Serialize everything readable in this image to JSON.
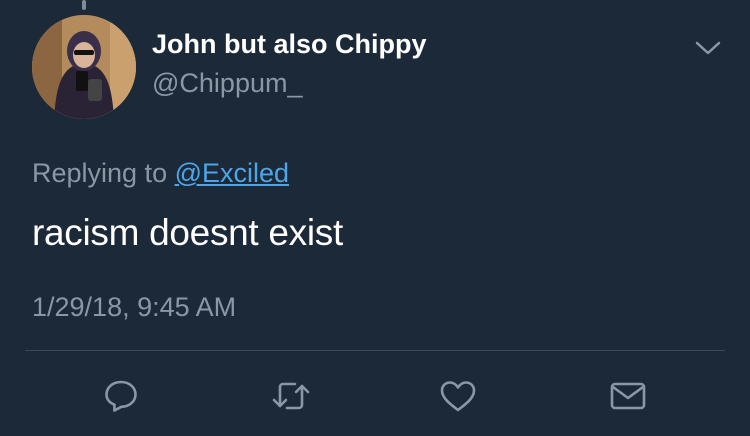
{
  "tweet": {
    "display_name": "John but also Chippy",
    "handle": "@Chippum_",
    "replying_prefix": "Replying to ",
    "replying_to": "@Exciled",
    "text": "racism doesnt exist",
    "timestamp": "1/29/18, 9:45 AM"
  },
  "icons": {
    "more": "chevron-down-icon",
    "reply": "reply-icon",
    "retweet": "retweet-icon",
    "like": "heart-icon",
    "message": "envelope-icon"
  },
  "colors": {
    "background": "#1c2938",
    "text": "#ffffff",
    "secondary_text": "#8a98a6",
    "link": "#4ca6e7",
    "icon": "#8a98a6"
  }
}
